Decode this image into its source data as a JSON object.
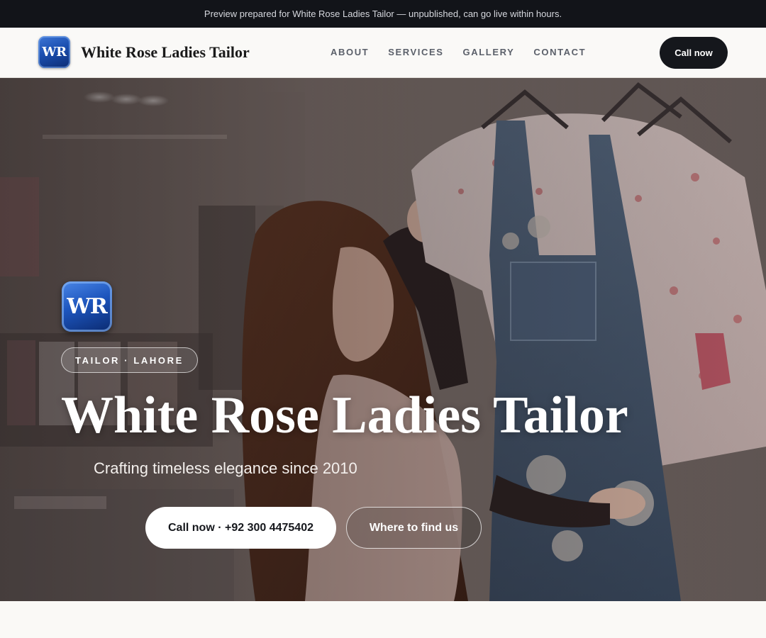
{
  "banner": {
    "text": "Preview prepared for White Rose Ladies Tailor — unpublished, can go live within hours."
  },
  "header": {
    "logo_text": "WR",
    "brand_name": "White Rose Ladies Tailor",
    "nav": [
      {
        "label": "ABOUT"
      },
      {
        "label": "SERVICES"
      },
      {
        "label": "GALLERY"
      },
      {
        "label": "CONTACT"
      }
    ],
    "cta_label": "Call now"
  },
  "hero": {
    "logo_text": "WR",
    "tag": "TAILOR · LAHORE",
    "title": "White Rose Ladies Tailor",
    "subtitle": "Crafting timeless elegance since 2010",
    "primary_button": "Call now · +92 300 4475402",
    "secondary_button": "Where to find us"
  },
  "colors": {
    "banner_bg": "#121419",
    "nav_cta_bg": "#15171c",
    "logo_blue": "#1b4fb1",
    "page_bg": "#faf9f6"
  }
}
